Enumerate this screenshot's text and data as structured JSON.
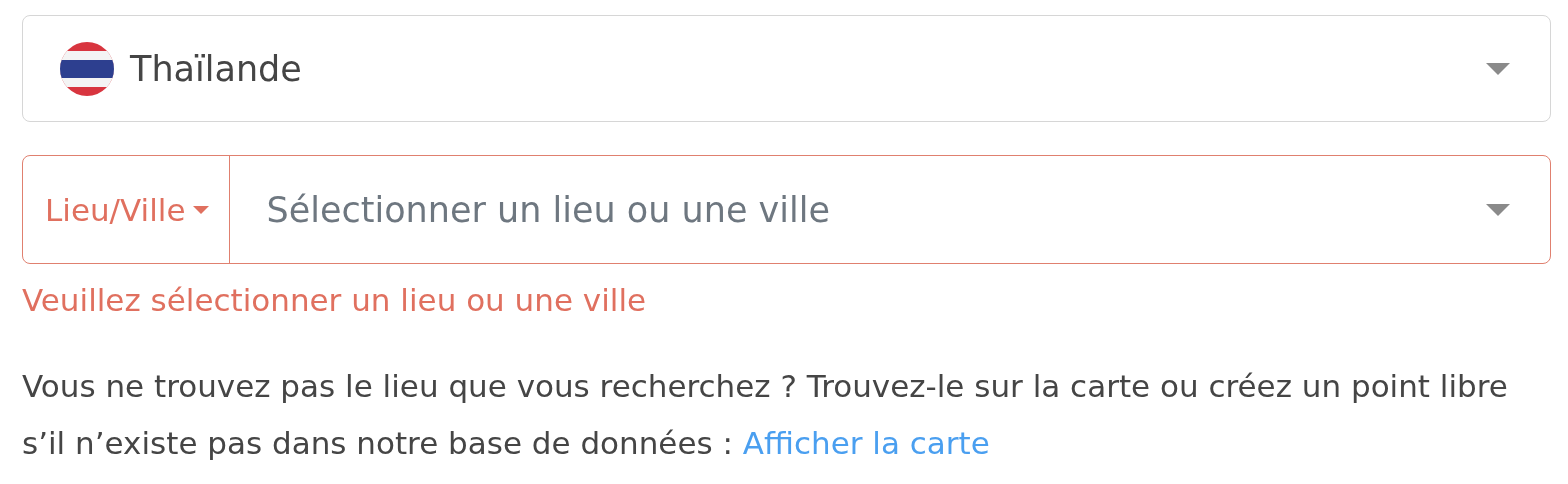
{
  "country_select": {
    "value": "Thaïlande"
  },
  "location": {
    "type_button": {
      "label": "Lieu/Ville"
    },
    "placeholder": "Sélectionner un lieu ou une ville",
    "invalid": true,
    "error": "Veuillez sélectionner un lieu ou une ville"
  },
  "help": {
    "text": "Vous ne trouvez pas le lieu que vous recherchez ? Trouvez-le sur la carte ou créez un point libre s’il n’existe pas dans notre base de données : ",
    "link": "Afficher la carte"
  }
}
